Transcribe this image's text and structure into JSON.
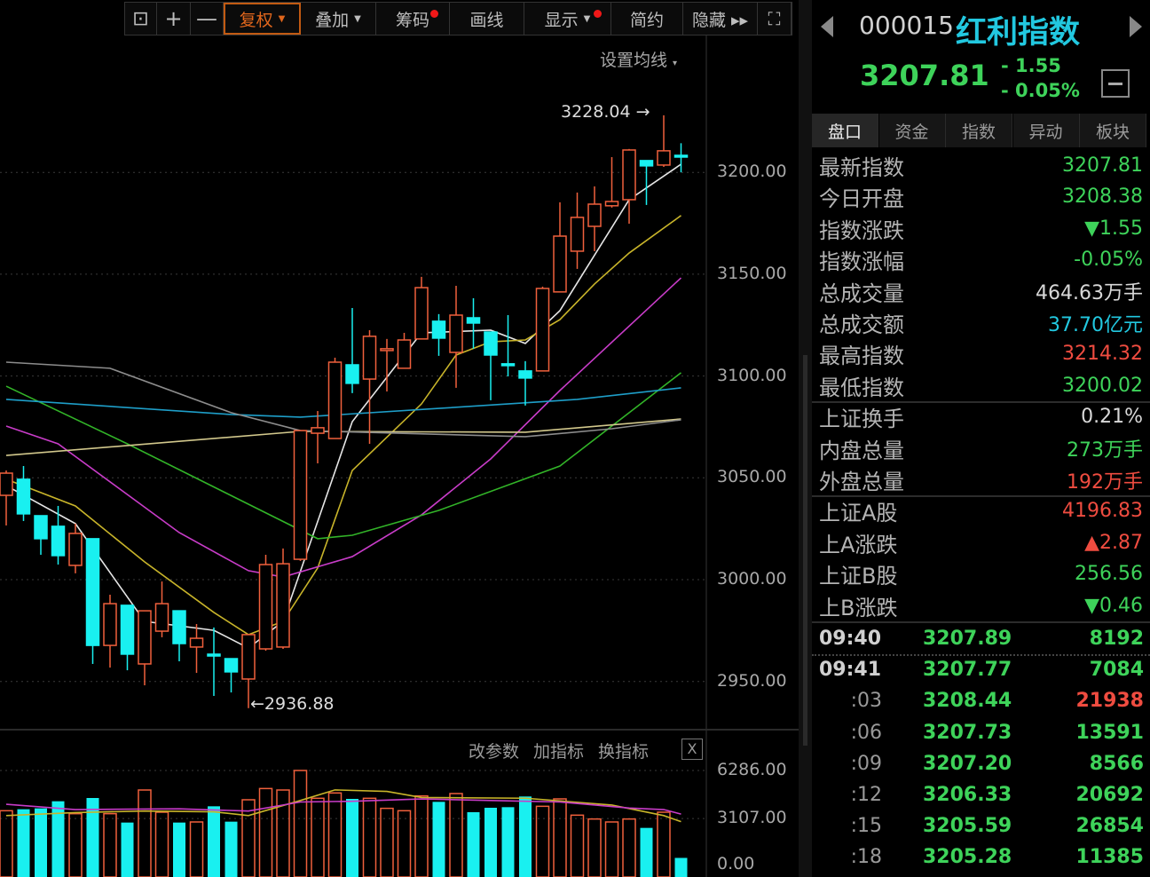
{
  "toolbar": {
    "buttons": [
      {
        "label": "",
        "icon": "unlock-icon"
      },
      {
        "label": "+",
        "icon": "zoom-in-icon"
      },
      {
        "label": "—",
        "icon": "zoom-out-icon"
      },
      {
        "label": "复权",
        "caret": true,
        "active": true
      },
      {
        "label": "叠加",
        "caret": true
      },
      {
        "label": "筹码",
        "dot": true
      },
      {
        "label": "画线"
      },
      {
        "label": "显示",
        "caret": true,
        "dot": true
      },
      {
        "label": "简约"
      },
      {
        "label": "隐藏 ▸▸"
      },
      {
        "label": "",
        "icon": "fullscreen-icon"
      }
    ]
  },
  "chart": {
    "ma_setting": "设置均线",
    "high_label": "3228.04",
    "low_label": "2936.88",
    "price_ticks": [
      "3200.00",
      "3150.00",
      "3100.00",
      "3050.00",
      "3000.00",
      "2950.00"
    ],
    "volume_ticks": [
      "6286.00",
      "3107.00",
      "0.00"
    ],
    "volume_actions": [
      "改参数",
      "加指标",
      "换指标"
    ],
    "volume_close": "X"
  },
  "chart_data": {
    "type": "candlestick",
    "ylim": [
      2936.88,
      3228.04
    ],
    "volume_max": 6286,
    "candles": [
      [
        3041.4,
        3053.6,
        3026.6,
        3052.3
      ],
      [
        3049.3,
        3055.8,
        3028.8,
        3032.3
      ],
      [
        3031.4,
        3031.4,
        3012.2,
        3020.1
      ],
      [
        3026.2,
        3036.2,
        3007.4,
        3011.8
      ],
      [
        3007.0,
        3027.5,
        3003.1,
        3022.7
      ],
      [
        3020.1,
        3020.1,
        2958.6,
        2967.7
      ],
      [
        2967.7,
        2992.6,
        2956.8,
        2988.2
      ],
      [
        2987.4,
        2987.4,
        2955.5,
        2963.4
      ],
      [
        2958.6,
        2984.7,
        2948.1,
        2984.7
      ],
      [
        2974.7,
        2999.1,
        2971.7,
        2988.2
      ],
      [
        2984.7,
        2984.7,
        2959.9,
        2968.6
      ],
      [
        2966.9,
        2978.2,
        2954.2,
        2971.2
      ],
      [
        2963.4,
        2976.5,
        2942.9,
        2962.5
      ],
      [
        2961.2,
        2961.2,
        2944.6,
        2954.7
      ],
      [
        2951.2,
        2973.0,
        2936.88,
        2973.0
      ],
      [
        2966.0,
        3012.2,
        2965.1,
        3007.4
      ],
      [
        2966.9,
        3015.3,
        2966.0,
        3007.8
      ],
      [
        3010.0,
        3073.2,
        3009.2,
        3073.2
      ],
      [
        3071.9,
        3082.8,
        3057.1,
        3074.6
      ],
      [
        3069.3,
        3109.0,
        3069.3,
        3106.8
      ],
      [
        3105.5,
        3133.4,
        3091.6,
        3096.4
      ],
      [
        3098.5,
        3122.5,
        3066.7,
        3119.5
      ],
      [
        3112.5,
        3118.2,
        3092.4,
        3113.4
      ],
      [
        3103.8,
        3121.2,
        3103.8,
        3117.7
      ],
      [
        3118.2,
        3148.7,
        3118.2,
        3143.4
      ],
      [
        3126.9,
        3130.4,
        3109.9,
        3118.6
      ],
      [
        3111.6,
        3144.3,
        3094.2,
        3129.9
      ],
      [
        3128.6,
        3138.2,
        3113.4,
        3126.0
      ],
      [
        3121.6,
        3121.6,
        3088.1,
        3110.3
      ],
      [
        3106.0,
        3129.9,
        3099.8,
        3105.1
      ],
      [
        3102.5,
        3107.3,
        3085.5,
        3099.0
      ],
      [
        3102.5,
        3143.9,
        3102.5,
        3143.0
      ],
      [
        3141.3,
        3185.3,
        3141.3,
        3168.7
      ],
      [
        3161.3,
        3190.1,
        3152.6,
        3177.9
      ],
      [
        3173.5,
        3193.1,
        3161.3,
        3184.4
      ],
      [
        3183.6,
        3207.5,
        3182.7,
        3185.7
      ],
      [
        3186.6,
        3211.5,
        3174.8,
        3211.0
      ],
      [
        3205.8,
        3205.8,
        3184.0,
        3203.2
      ],
      [
        3203.6,
        3228.04,
        3202.7,
        3210.6
      ],
      [
        3208.38,
        3214.32,
        3200.02,
        3207.81
      ]
    ],
    "volumes": [
      3623,
      3721,
      3780,
      4250,
      3427,
      4465,
      3427,
      2840,
      4994,
      3525,
      2840,
      2879,
      3916,
      2899,
      4348,
      5091,
      4994,
      6286,
      4446,
      4798,
      4406,
      4446,
      3780,
      3623,
      4602,
      4211,
      4759,
      3525,
      3819,
      3858,
      4563,
      3916,
      4406,
      3329,
      3074,
      2879,
      3074,
      2487,
      3525,
      500
    ],
    "ma_lines": [
      {
        "name": "MA5",
        "color": "#e6e6e6",
        "points": [
          [
            0,
            3046.2
          ],
          [
            4,
            3027.5
          ],
          [
            8,
            2979.5
          ],
          [
            12,
            2975.1
          ],
          [
            14,
            2966.4
          ],
          [
            16,
            2979.5
          ],
          [
            20,
            3077.6
          ],
          [
            24,
            3121.2
          ],
          [
            28,
            3122.5
          ],
          [
            30,
            3116
          ],
          [
            32,
            3132.1
          ],
          [
            36,
            3186.6
          ],
          [
            39,
            3204.0
          ]
        ]
      },
      {
        "name": "MA10",
        "color": "#c8b42a",
        "points": [
          [
            0,
            3049.3
          ],
          [
            4,
            3036.2
          ],
          [
            8,
            3008.7
          ],
          [
            12,
            2983.9
          ],
          [
            14,
            2973.0
          ],
          [
            16,
            2979.5
          ],
          [
            18,
            3005.7
          ],
          [
            20,
            3053.6
          ],
          [
            24,
            3086.3
          ],
          [
            26,
            3110.3
          ],
          [
            28,
            3116.8
          ],
          [
            30,
            3117.7
          ],
          [
            32,
            3127.7
          ],
          [
            34,
            3145.2
          ],
          [
            36,
            3160.4
          ],
          [
            39,
            3178.8
          ]
        ]
      },
      {
        "name": "MA20",
        "color": "#c83cc8",
        "points": [
          [
            0,
            3075.4
          ],
          [
            3,
            3066.7
          ],
          [
            10,
            3023.1
          ],
          [
            14,
            3004.4
          ],
          [
            16,
            3001.3
          ],
          [
            20,
            3011.3
          ],
          [
            24,
            3031.8
          ],
          [
            28,
            3059.3
          ],
          [
            32,
            3092.9
          ],
          [
            39,
            3148.2
          ]
        ]
      },
      {
        "name": "MA30",
        "color": "#32b428",
        "points": [
          [
            0,
            3095.0
          ],
          [
            7,
            3066.7
          ],
          [
            18,
            3020.1
          ],
          [
            20,
            3021.8
          ],
          [
            25,
            3034.0
          ],
          [
            32,
            3055.8
          ],
          [
            39,
            3101.6
          ]
        ]
      },
      {
        "name": "MA60",
        "color": "#1e9ec8",
        "points": [
          [
            0,
            3088.5
          ],
          [
            13,
            3081.1
          ],
          [
            17,
            3079.8
          ],
          [
            25,
            3084.1
          ],
          [
            33,
            3088.5
          ],
          [
            39,
            3094.2
          ]
        ]
      },
      {
        "name": "MA120",
        "color": "#d2c88c",
        "points": [
          [
            0,
            3061.0
          ],
          [
            17,
            3072.8
          ],
          [
            30,
            3072.4
          ],
          [
            39,
            3078.9
          ]
        ]
      },
      {
        "name": "MA250",
        "color": "#8c8c8c",
        "points": [
          [
            0,
            3106.8
          ],
          [
            6,
            3103.8
          ],
          [
            13,
            3082.0
          ],
          [
            17,
            3073.2
          ],
          [
            30,
            3070.2
          ],
          [
            35,
            3074.1
          ],
          [
            39,
            3078.5
          ]
        ]
      }
    ],
    "volume_ma_lines": [
      {
        "name": "VMA5",
        "color": "#c8b42a",
        "points": [
          [
            0,
            3300
          ],
          [
            4,
            3500
          ],
          [
            8,
            3600
          ],
          [
            12,
            3550
          ],
          [
            14,
            3300
          ],
          [
            17,
            4300
          ],
          [
            19,
            5000
          ],
          [
            22,
            4900
          ],
          [
            24,
            4500
          ],
          [
            30,
            4450
          ],
          [
            35,
            4000
          ],
          [
            38,
            3300
          ],
          [
            39,
            2900
          ]
        ]
      },
      {
        "name": "VMA10",
        "color": "#c83cc8",
        "points": [
          [
            0,
            4050
          ],
          [
            4,
            3700
          ],
          [
            10,
            3750
          ],
          [
            14,
            3600
          ],
          [
            17,
            4200
          ],
          [
            20,
            4250
          ],
          [
            24,
            4400
          ],
          [
            28,
            4300
          ],
          [
            32,
            4200
          ],
          [
            36,
            3800
          ],
          [
            38,
            3700
          ],
          [
            39,
            3400
          ]
        ]
      }
    ]
  },
  "quote": {
    "code": "000015",
    "name": "红利指数",
    "price": "3207.81",
    "change": "- 1.55",
    "change_pct": "- 0.05%"
  },
  "tabs": [
    "盘口",
    "资金",
    "指数",
    "异动",
    "板块"
  ],
  "stats": [
    {
      "label": "最新指数",
      "value": "3207.81",
      "cls": "g"
    },
    {
      "label": "今日开盘",
      "value": "3208.38",
      "cls": "g"
    },
    {
      "label": "指数涨跌",
      "value": "▼1.55",
      "cls": "g"
    },
    {
      "label": "指数涨幅",
      "value": "-0.05%",
      "cls": "g"
    },
    {
      "label": "总成交量",
      "value": "464.63万手",
      "cls": "w"
    },
    {
      "label": "总成交额",
      "value": "37.70亿元",
      "cls": "c"
    },
    {
      "label": "最高指数",
      "value": "3214.32",
      "cls": "r"
    },
    {
      "label": "最低指数",
      "value": "3200.02",
      "cls": "g"
    },
    {
      "label": "上证换手",
      "value": "0.21%",
      "cls": "w"
    },
    {
      "label": "内盘总量",
      "value": "273万手",
      "cls": "g"
    },
    {
      "label": "外盘总量",
      "value": "192万手",
      "cls": "r"
    },
    {
      "label": "上证A股",
      "value": "4196.83",
      "cls": "r"
    },
    {
      "label": "上A涨跌",
      "value": "▲2.87",
      "cls": "r"
    },
    {
      "label": "上证B股",
      "value": "256.56",
      "cls": "g"
    },
    {
      "label": "上B涨跌",
      "value": "▼0.46",
      "cls": "g"
    }
  ],
  "ticks": [
    {
      "time": "09:40",
      "price": "3207.89",
      "vol": "8192",
      "vcls": "g",
      "main": true
    },
    {
      "time": "09:41",
      "price": "3207.77",
      "vol": "7084",
      "vcls": "g",
      "main": true
    },
    {
      "time": ":03",
      "price": "3208.44",
      "vol": "21938",
      "vcls": "r"
    },
    {
      "time": ":06",
      "price": "3207.73",
      "vol": "13591",
      "vcls": "g"
    },
    {
      "time": ":09",
      "price": "3207.20",
      "vol": "8566",
      "vcls": "g"
    },
    {
      "time": ":12",
      "price": "3206.33",
      "vol": "20692",
      "vcls": "g"
    },
    {
      "time": ":15",
      "price": "3205.59",
      "vol": "26854",
      "vcls": "g"
    },
    {
      "time": ":18",
      "price": "3205.28",
      "vol": "11385",
      "vcls": "g"
    }
  ],
  "colors": {
    "up": "#f0603c",
    "down": "#19f0f0",
    "green": "#3ed35a",
    "red": "#ef4c40",
    "accent": "#22c8e0"
  }
}
